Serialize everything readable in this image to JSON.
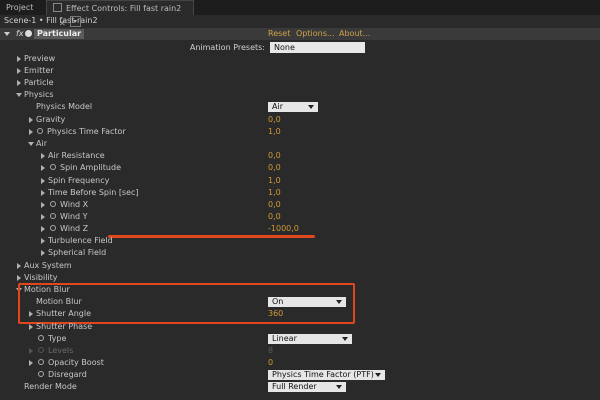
{
  "tabs": {
    "project": "Project",
    "effect_controls": "Effect Controls: Fill fast rain2"
  },
  "breadcrumb": "Scene-1 • Fill fast rain2",
  "effect": {
    "fx": "fx",
    "name": "Particular",
    "reset": "Reset",
    "options": "Options...",
    "about": "About..."
  },
  "animation_presets": {
    "label": "Animation Presets:",
    "value": "None"
  },
  "params": {
    "preview": "Preview",
    "emitter": "Emitter",
    "particle": "Particle",
    "physics": "Physics",
    "physics_model": {
      "label": "Physics Model",
      "value": "Air"
    },
    "gravity": {
      "label": "Gravity",
      "value": "0,0"
    },
    "physics_time_factor": {
      "label": "Physics Time Factor",
      "value": "1,0"
    },
    "air": "Air",
    "air_resistance": {
      "label": "Air Resistance",
      "value": "0,0"
    },
    "spin_amplitude": {
      "label": "Spin Amplitude",
      "value": "0,0"
    },
    "spin_frequency": {
      "label": "Spin Frequency",
      "value": "1,0"
    },
    "time_before_spin": {
      "label": "Time Before Spin [sec]",
      "value": "1,0"
    },
    "wind_x": {
      "label": "Wind X",
      "value": "0,0"
    },
    "wind_y": {
      "label": "Wind Y",
      "value": "0,0"
    },
    "wind_z": {
      "label": "Wind Z",
      "value": "-1000,0"
    },
    "turbulence_field": "Turbulence Field",
    "spherical_field": "Spherical Field",
    "aux_system": "Aux System",
    "visibility": "Visibility",
    "motion_blur_group": "Motion Blur",
    "motion_blur": {
      "label": "Motion Blur",
      "value": "On"
    },
    "shutter_angle": {
      "label": "Shutter Angle",
      "value": "360"
    },
    "shutter_phase": "Shutter Phase",
    "type": {
      "label": "Type",
      "value": "Linear"
    },
    "levels": {
      "label": "Levels",
      "value": "8"
    },
    "opacity_boost": {
      "label": "Opacity Boost",
      "value": "0"
    },
    "disregard": {
      "label": "Disregard",
      "value": "Physics Time Factor (PTF)"
    },
    "render_mode": {
      "label": "Render Mode",
      "value": "Full Render"
    }
  },
  "colors": {
    "value_orange": "#d09b36",
    "annotation_red": "#e2461c",
    "panel_bg": "#2a2a2a"
  }
}
